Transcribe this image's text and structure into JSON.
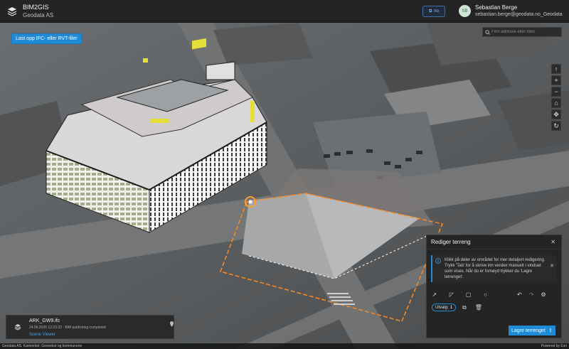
{
  "header": {
    "app_title": "BIM2GIS",
    "org": "Geodata AS",
    "language": "no",
    "user": {
      "initials": "SB",
      "name": "Sebastian Berge",
      "email": "sebastian.berge@geodata.no_Geodata"
    }
  },
  "map": {
    "upload_button": "Last opp IFC- eller RVT-filer",
    "search_placeholder": "Finn adresse eller sted",
    "tools": [
      "compass-icon",
      "zoom-in-icon",
      "zoom-out-icon",
      "home-icon",
      "pan-icon",
      "rotate-icon"
    ]
  },
  "terrain_panel": {
    "title": "Rediger terreng",
    "info": "Klikk på deler av området for mer detaljert redigering. Trykk 'Tab' for å skrive inn verdier manuelt i vinduet som vises. Når du er fornøyd trykker du 'Lagre terrenget'.",
    "selection_label": "Utvalg:",
    "selection_count": "1",
    "save_label": "Lagre terrenget"
  },
  "file_card": {
    "name": "ARK_GW9.ifc",
    "meta": "24.06.2025 12:23:22 · BIM publishing completed",
    "link": "Scene Viewer"
  },
  "footer": {
    "attribution": "Geodata AS, Kartverket, Geovekst og kommunene",
    "powered": "Powered by Esri"
  },
  "colors": {
    "accent": "#1f8bd6",
    "outline": "#ff8a1f"
  }
}
